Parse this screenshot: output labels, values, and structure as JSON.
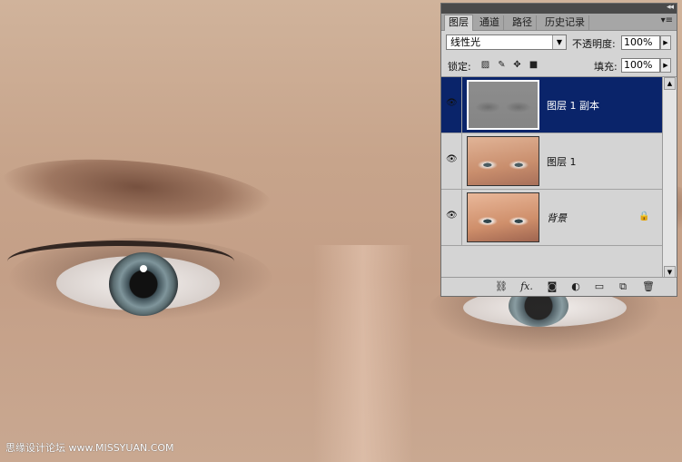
{
  "watermark": "思缘设计论坛 www.MISSYUAN.COM",
  "panel": {
    "collapse_glyph": "◂◂",
    "tabs": [
      "图层",
      "通道",
      "路径",
      "历史记录"
    ],
    "menu_glyph": "▾≡",
    "blend_mode": "线性光",
    "opacity_label": "不透明度:",
    "opacity_value": "100%",
    "lock_label": "锁定:",
    "fill_label": "填充:",
    "fill_value": "100%",
    "layers": [
      {
        "name": "图层 1 副本",
        "selected": true,
        "locked": false
      },
      {
        "name": "图层 1",
        "selected": false,
        "locked": false
      },
      {
        "name": "背景",
        "selected": false,
        "locked": true
      }
    ]
  },
  "icons": {
    "eye": "eye-icon",
    "lock": "lock-icon",
    "link": "link-layers-icon",
    "fx": "layer-style-icon",
    "mask": "add-mask-icon",
    "adjust": "adjustment-layer-icon",
    "group": "new-group-icon",
    "newlayer": "new-layer-icon",
    "trash": "delete-layer-icon"
  },
  "labels": {
    "fx": "fx."
  }
}
